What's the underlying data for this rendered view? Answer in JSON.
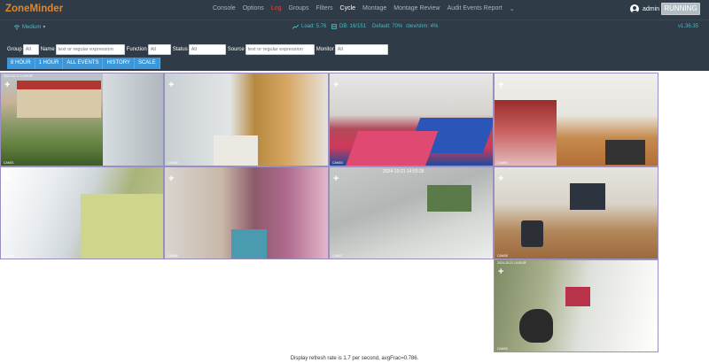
{
  "app": {
    "title": "ZoneMinder",
    "user": "admin",
    "state": "RUNNING"
  },
  "nav": {
    "items": [
      {
        "label": "Console",
        "state": "normal"
      },
      {
        "label": "Options",
        "state": "normal"
      },
      {
        "label": "Log",
        "state": "log"
      },
      {
        "label": "Groups",
        "state": "normal"
      },
      {
        "label": "Filters",
        "state": "normal"
      },
      {
        "label": "Cycle",
        "state": "active"
      },
      {
        "label": "Montage",
        "state": "normal"
      },
      {
        "label": "Montage Review",
        "state": "normal"
      },
      {
        "label": "Audit Events Report",
        "state": "normal"
      }
    ],
    "more_icon": "chevron-down-icon"
  },
  "status": {
    "bandwidth": "Medium",
    "load": "Load: 5.76",
    "db": "DB: 16/151",
    "storage": "Default: 70%",
    "shm": "/dev/shm: 4%",
    "version": "v1.36.35"
  },
  "filters": {
    "group": {
      "label": "Group",
      "placeholder": "All"
    },
    "name": {
      "label": "Name",
      "placeholder": "text or regular expression"
    },
    "function": {
      "label": "Function",
      "placeholder": "All"
    },
    "status": {
      "label": "Status",
      "placeholder": "All"
    },
    "source": {
      "label": "Source",
      "placeholder": "text or regular expression"
    },
    "monitor": {
      "label": "Monitor",
      "placeholder": "All"
    }
  },
  "buttons": [
    "8 HOUR",
    "1 HOUR",
    "ALL EVENTS",
    "HISTORY",
    "SCALE"
  ],
  "monitors": [
    {
      "ts": "2024-10-21 14:50:28",
      "cam": "CAM01"
    },
    {
      "ts": "",
      "cam": "CAM02"
    },
    {
      "ts": "",
      "cam": "CAM03"
    },
    {
      "ts": "",
      "cam": "CAM04"
    },
    {
      "ts": "",
      "cam": "CAM05"
    },
    {
      "ts": "",
      "cam": "CAM06"
    },
    {
      "ts": "2024-10-21 14:50:28",
      "cam": "CAM07"
    },
    {
      "ts": "",
      "cam": "CAM08"
    },
    {
      "ts": "2024-10-21 14:50:28",
      "cam": "CAM09"
    }
  ],
  "footer": "Display refresh rate is 1.7 per second, avgFrac=0.786."
}
